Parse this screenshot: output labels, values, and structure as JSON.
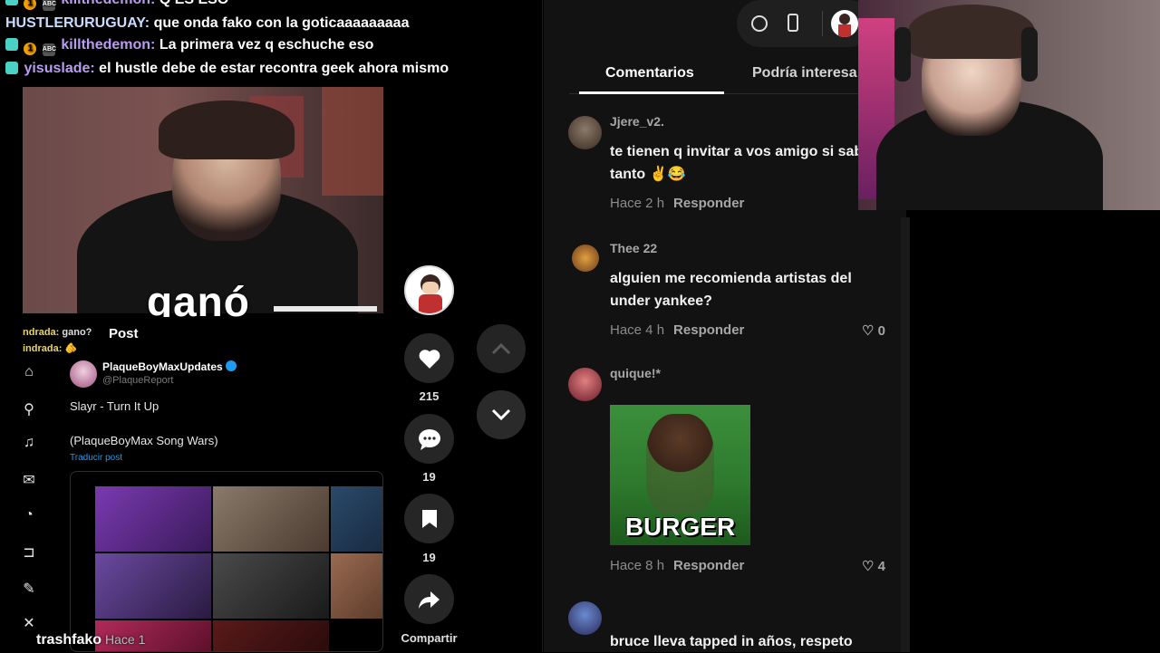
{
  "chat": {
    "lines": [
      {
        "user": "killthedemon:",
        "text": "Q ES ESO"
      },
      {
        "user": "HUSTLERURUGUAY:",
        "text": "que onda fako con la goticaaaaaaaaa"
      },
      {
        "user": "killthedemon:",
        "text": "La primera vez q eschuche eso"
      },
      {
        "user": "yisuslade:",
        "text": "el hustle debe de estar recontra geek ahora mismo"
      }
    ],
    "badge_number": "1",
    "badge_abc": "ABC"
  },
  "overlay": {
    "caption": "ganó"
  },
  "twitter": {
    "post_title": "Post",
    "account_name": "PlaqueBoyMaxUpdates",
    "handle": "@PlaqueReport",
    "text_line1": "Slayr - Turn It Up",
    "text_line2": "(PlaqueBoyMax Song Wars)",
    "translate": "Traducir post",
    "side_chat": [
      {
        "user": "ndrada:",
        "text": "gano?"
      },
      {
        "user": "indrada:",
        "text": "🫵"
      }
    ]
  },
  "stream": {
    "name": "trashfako",
    "time": "Hace 1"
  },
  "actions": {
    "likes": "215",
    "comments": "19",
    "saves": "19",
    "share_label": "Compartir"
  },
  "panel": {
    "tabs": [
      "Comentarios",
      "Podría interesa"
    ],
    "comments": [
      {
        "user": "Jjere_v2.",
        "text": "te tienen q invitar a vos amigo si sabes tanto ✌️😂",
        "time": "Hace 2 h",
        "reply": "Responder",
        "likes": ""
      },
      {
        "user": "Thee 22",
        "text": "alguien me recomienda artistas del under yankee?",
        "time": "Hace 4 h",
        "reply": "Responder",
        "likes": "0"
      },
      {
        "user": "quique!*",
        "text": "",
        "gif_text": "BURGER",
        "time": "Hace 8 h",
        "reply": "Responder",
        "likes": "4"
      },
      {
        "user": "",
        "text": "bruce lleva tapped in años, respeto",
        "time": "",
        "reply": "",
        "likes": ""
      }
    ]
  },
  "colors": {
    "accent_user": "#b99df0",
    "bg_panel": "#121212",
    "verified": "#1d9bf0"
  }
}
